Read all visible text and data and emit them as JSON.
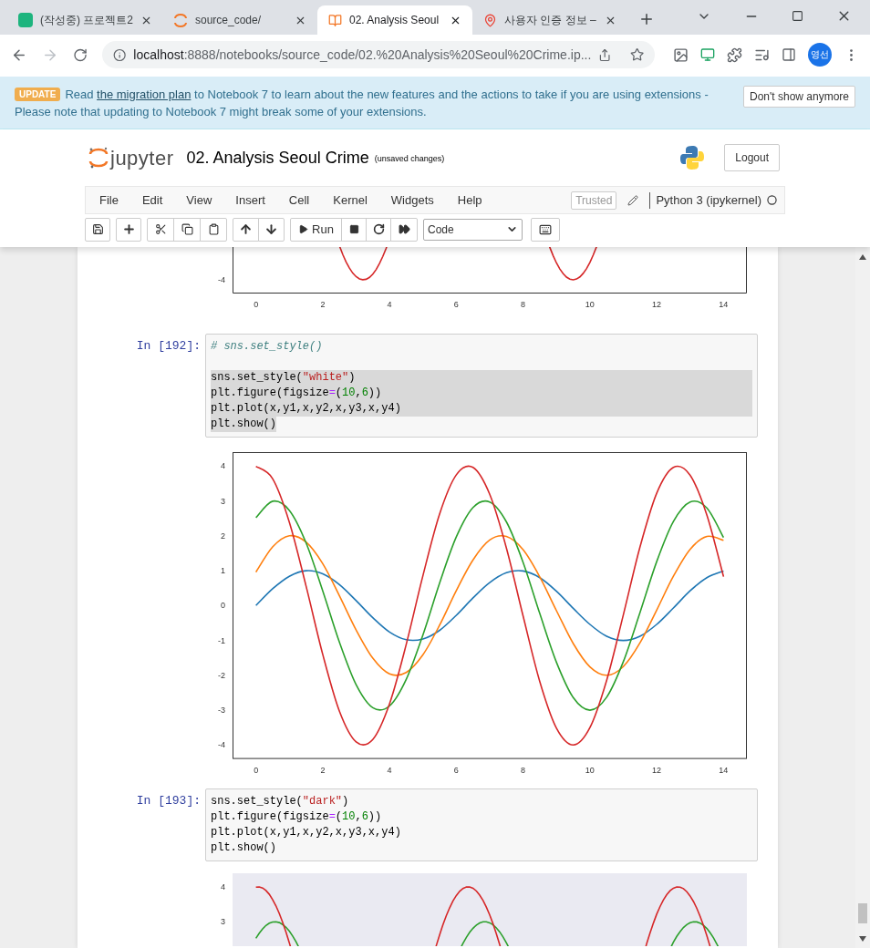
{
  "browser": {
    "tabs": [
      {
        "title": "(작성중) 프로젝트2",
        "kind": "v",
        "selected": false
      },
      {
        "title": "source_code/",
        "kind": "jupyter",
        "selected": false
      },
      {
        "title": "02. Analysis Seoul",
        "kind": "notebook",
        "selected": true
      },
      {
        "title": "사용자 인증 정보 –",
        "kind": "maps",
        "selected": false
      }
    ],
    "address": {
      "host": "localhost",
      "path": ":8888/notebooks/source_code/02.%20Analysis%20Seoul%20Crime.ip..."
    },
    "profile": {
      "initials": "영선"
    }
  },
  "banner": {
    "badge": "UPDATE",
    "before": "Read ",
    "link": "the migration plan",
    "after": " to Notebook 7 to learn about the new features and the actions to take if you are using extensions - Please note that updating to Notebook 7 might break some of your extensions.",
    "button": "Don't show anymore"
  },
  "header": {
    "logo_text": "jupyter",
    "title": "02. Analysis Seoul Crime",
    "status": "(unsaved changes)",
    "logout": "Logout"
  },
  "menubar": {
    "items": [
      "File",
      "Edit",
      "View",
      "Insert",
      "Cell",
      "Kernel",
      "Widgets",
      "Help"
    ],
    "trusted": "Trusted",
    "kernel": "Python 3 (ipykernel)",
    "kernel_busy": false
  },
  "toolbar": {
    "run": "Run",
    "cell_type": "Code"
  },
  "notebook": [
    {
      "kind": "plot_bottom_part",
      "x_tick_labels": [
        "0",
        "2",
        "4",
        "6",
        "8",
        "10",
        "12",
        "14"
      ],
      "y_tick_labels": [
        "-4"
      ]
    },
    {
      "kind": "code_cell",
      "prompt": "In [192]:",
      "lines": [
        {
          "kind": "code",
          "selected": false,
          "segments": [
            {
              "kind": "comment",
              "text": "# sns.set_style()"
            }
          ]
        },
        {
          "kind": "blank",
          "selected": false
        },
        {
          "kind": "code",
          "selected": true,
          "segments": [
            {
              "kind": "plain",
              "text": "sns.set_style("
            },
            {
              "kind": "string",
              "text": "\"white\""
            },
            {
              "kind": "plain",
              "text": ")"
            }
          ]
        },
        {
          "kind": "code",
          "selected": true,
          "segments": [
            {
              "kind": "plain",
              "text": "plt.figure(figsize"
            },
            {
              "kind": "operator",
              "text": "="
            },
            {
              "kind": "plain",
              "text": "("
            },
            {
              "kind": "number",
              "text": "10"
            },
            {
              "kind": "plain",
              "text": ","
            },
            {
              "kind": "number",
              "text": "6"
            },
            {
              "kind": "plain",
              "text": "))"
            }
          ]
        },
        {
          "kind": "code",
          "selected": true,
          "segments": [
            {
              "kind": "plain",
              "text": "plt.plot(x,y1,x,y2,x,y3,x,y4)"
            }
          ]
        },
        {
          "kind": "code",
          "selected": true,
          "segments": [
            {
              "kind": "plain",
              "text": "plt.show()"
            }
          ]
        }
      ]
    },
    {
      "kind": "chart_output",
      "chart_data": {
        "type": "line",
        "x": [
          0,
          0.5,
          1,
          1.5,
          2,
          2.5,
          3,
          3.5,
          4,
          4.5,
          5,
          5.5,
          6,
          6.5,
          7,
          7.5,
          8,
          8.5,
          9,
          9.5,
          10,
          10.5,
          11,
          11.5,
          12,
          12.5,
          13,
          13.5,
          14
        ],
        "xlim": [
          -0.7,
          14.7
        ],
        "ylim": [
          -4.4,
          4.4
        ],
        "xticks": [
          0,
          2,
          4,
          6,
          8,
          10,
          12,
          14
        ],
        "yticks": [
          -4,
          -3,
          -2,
          -1,
          0,
          1,
          2,
          3,
          4
        ],
        "series": [
          {
            "color": "#1f77b4",
            "values": [
              0,
              0.48,
              0.84,
              1.0,
              0.91,
              0.6,
              0.14,
              -0.35,
              -0.76,
              -0.98,
              -0.96,
              -0.71,
              -0.28,
              0.22,
              0.66,
              0.94,
              0.99,
              0.8,
              0.41,
              -0.08,
              -0.54,
              -0.88,
              -1.0,
              -0.88,
              -0.54,
              -0.07,
              0.42,
              0.8,
              0.99
            ]
          },
          {
            "color": "#ff7f0e",
            "values": [
              0.96,
              1.68,
              2.0,
              1.82,
              1.2,
              0.28,
              -0.7,
              -1.51,
              -1.96,
              -1.92,
              -1.41,
              -0.56,
              0.43,
              1.31,
              1.88,
              1.98,
              1.6,
              0.82,
              -0.15,
              -1.09,
              -1.76,
              -2.0,
              -1.75,
              -1.07,
              -0.13,
              0.84,
              1.61,
              1.98,
              1.87
            ]
          },
          {
            "color": "#2ca02c",
            "values": [
              2.52,
              2.99,
              2.73,
              1.8,
              0.42,
              -1.05,
              -2.27,
              -2.93,
              -2.88,
              -2.12,
              -0.84,
              0.65,
              1.97,
              2.81,
              2.97,
              2.4,
              1.24,
              -0.23,
              -1.63,
              -2.64,
              -3.0,
              -2.63,
              -1.61,
              -0.2,
              1.26,
              2.41,
              2.97,
              2.8,
              1.95
            ]
          },
          {
            "color": "#d62728",
            "values": [
              3.99,
              3.64,
              2.39,
              0.56,
              -1.4,
              -3.03,
              -3.91,
              -3.84,
              -2.82,
              -1.12,
              0.86,
              2.63,
              3.75,
              3.96,
              3.19,
              1.65,
              -0.3,
              -2.18,
              -3.52,
              -4.0,
              -3.5,
              -2.15,
              -0.27,
              1.68,
              3.22,
              3.96,
              3.74,
              2.6,
              0.83
            ]
          }
        ]
      }
    },
    {
      "kind": "code_cell",
      "prompt": "In [193]:",
      "lines": [
        {
          "kind": "code",
          "selected": false,
          "segments": [
            {
              "kind": "plain",
              "text": "sns.set_style("
            },
            {
              "kind": "string",
              "text": "\"dark\""
            },
            {
              "kind": "plain",
              "text": ")"
            }
          ]
        },
        {
          "kind": "code",
          "selected": false,
          "segments": [
            {
              "kind": "plain",
              "text": "plt.figure(figsize"
            },
            {
              "kind": "operator",
              "text": "="
            },
            {
              "kind": "plain",
              "text": "("
            },
            {
              "kind": "number",
              "text": "10"
            },
            {
              "kind": "plain",
              "text": ","
            },
            {
              "kind": "number",
              "text": "6"
            },
            {
              "kind": "plain",
              "text": "))"
            }
          ]
        },
        {
          "kind": "code",
          "selected": false,
          "segments": [
            {
              "kind": "plain",
              "text": "plt.plot(x,y1,x,y2,x,y3,x,y4)"
            }
          ]
        },
        {
          "kind": "code",
          "selected": false,
          "segments": [
            {
              "kind": "plain",
              "text": "plt.show()"
            }
          ]
        }
      ]
    },
    {
      "kind": "dark_plot_top_part",
      "y_tick_labels": [
        "4",
        "3"
      ]
    }
  ]
}
